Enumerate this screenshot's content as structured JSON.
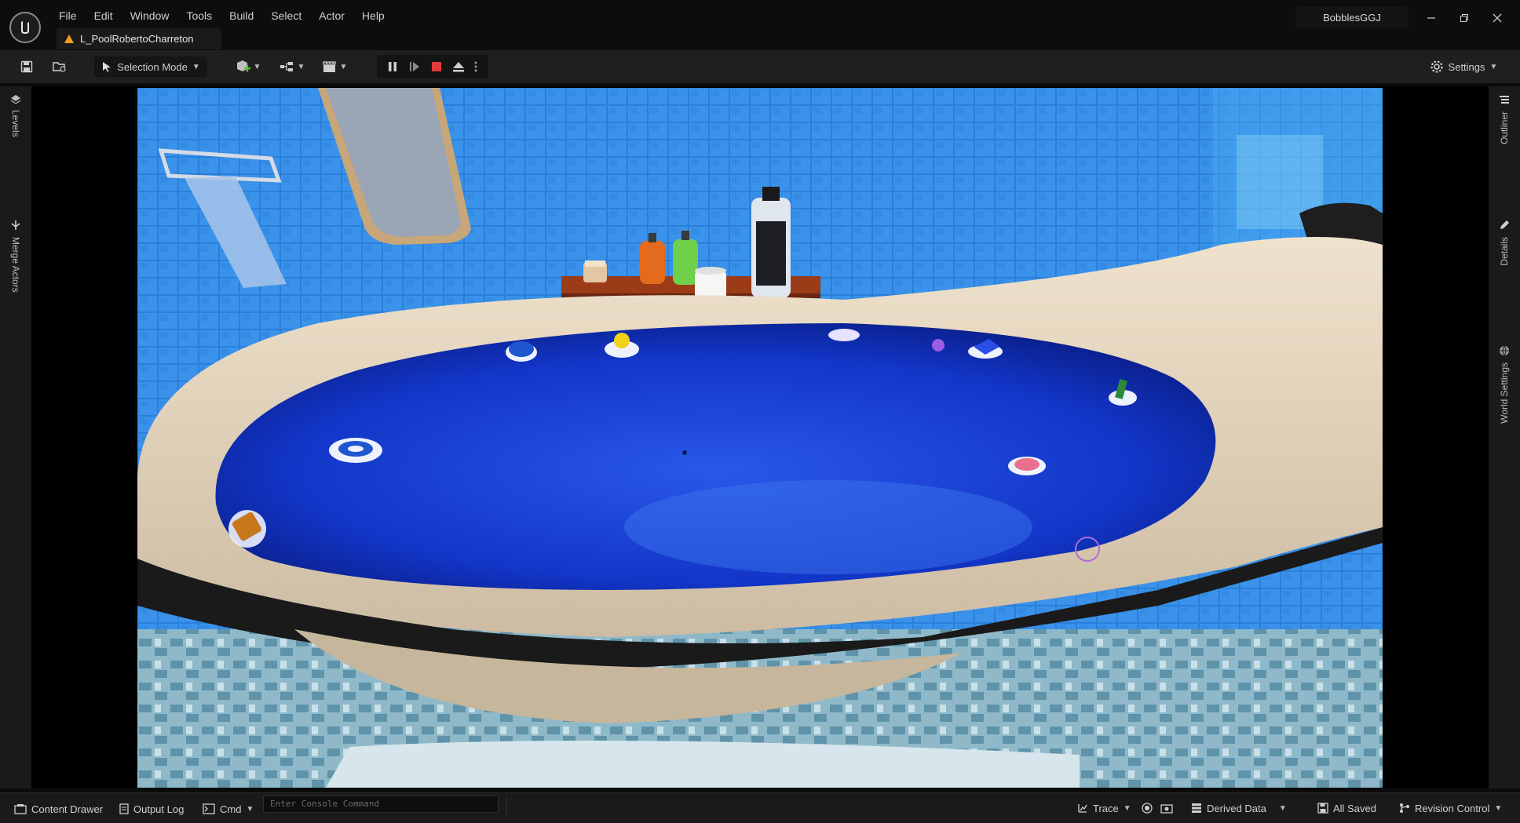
{
  "window": {
    "menu": [
      "File",
      "Edit",
      "Window",
      "Tools",
      "Build",
      "Select",
      "Actor",
      "Help"
    ],
    "level_tab": "L_PoolRobertoCharreton",
    "project": "BobblesGGJ",
    "controls": [
      "minimize-icon",
      "restore-icon",
      "close-icon"
    ]
  },
  "toolbar": {
    "selection_mode": "Selection Mode",
    "settings": "Settings",
    "play_controls": [
      "pause-icon",
      "frame-step-icon",
      "stop-icon",
      "eject-icon",
      "more-icon"
    ],
    "colors": {
      "stop": "#e23b3b",
      "accent_add": "#5fbf3a"
    }
  },
  "left_panel": {
    "tabs": [
      "Levels",
      "Merge Actors"
    ]
  },
  "right_panel": {
    "tabs": [
      "Outliner",
      "Details",
      "World Settings"
    ]
  },
  "statusbar": {
    "content_drawer": "Content Drawer",
    "output_log": "Output Log",
    "cmd": "Cmd",
    "console_placeholder": "Enter Console Command",
    "trace": "Trace",
    "derived_data": "Derived Data",
    "all_saved": "All Saved",
    "revision_control": "Revision Control"
  },
  "scene": {
    "colors": {
      "water": "#1236c8",
      "tile": "#2a7fd8",
      "tub": "#e8d6bf",
      "shelf": "#9b3b18"
    },
    "floating_items": [
      "blue-ball",
      "rubber-duck",
      "lilac-soap",
      "purple-toy",
      "blue-boat",
      "striped-toy",
      "blue-ring",
      "pink-soap",
      "orange-sponge",
      "bubble"
    ],
    "shelf_items": [
      "candle",
      "orange-bottle",
      "green-bottle",
      "toilet-roll",
      "shampoo-bottle"
    ]
  }
}
